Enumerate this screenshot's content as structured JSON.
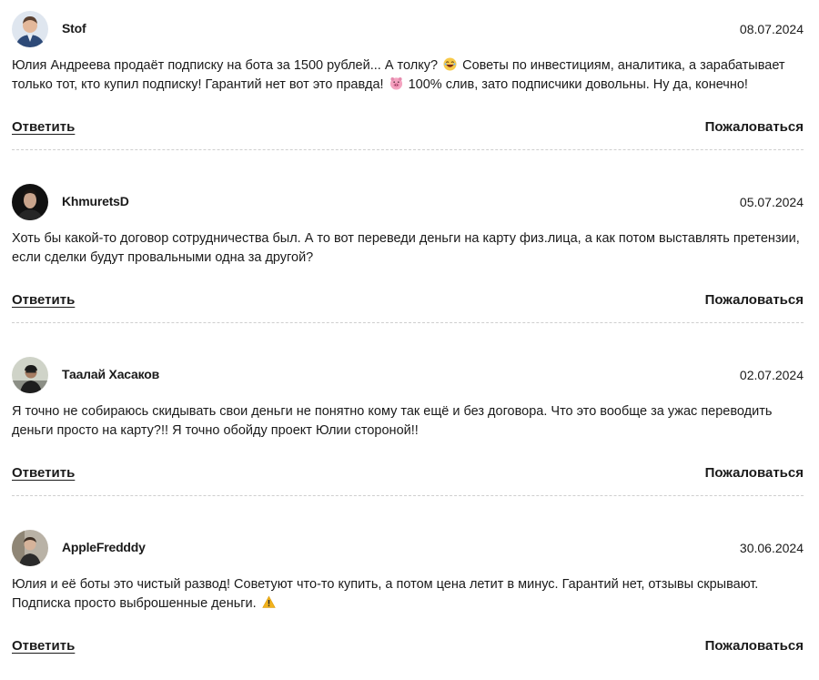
{
  "comments": [
    {
      "author": "Stof",
      "date": "08.07.2024",
      "text_parts": [
        "Юлия Андреева продаёт подписку на бота за 1500 рублей... А толку? ",
        " Советы по инвестициям, аналитика, а зарабатывает только тот, кто купил подписку! Гарантий нет вот это правда! ",
        " 100% слив, зато подписчики довольны. Ну да, конечно!"
      ],
      "emojis": [
        "laughing-emoji",
        "pig-face-emoji"
      ],
      "avatar_icon": "user-avatar-photo",
      "reply_label": "Ответить",
      "report_label": "Пожаловаться"
    },
    {
      "author": "KhmuretsD",
      "date": "05.07.2024",
      "text": "Хоть бы какой-то договор сотрудничества был. А то вот переведи деньги на карту физ.лица, а как потом выставлять претензии, если сделки будут провальными одна за другой?",
      "avatar_icon": "user-avatar-photo",
      "reply_label": "Ответить",
      "report_label": "Пожаловаться"
    },
    {
      "author": "Таалай Хасаков",
      "date": "02.07.2024",
      "text": "Я точно не собираюсь скидывать свои деньги не понятно кому так ещё и без договора. Что это вообще за ужас переводить деньги просто на карту?!! Я точно обойду проект Юлии стороной!!",
      "avatar_icon": "user-avatar-photo",
      "reply_label": "Ответить",
      "report_label": "Пожаловаться"
    },
    {
      "author": "AppleFredddy",
      "date": "30.06.2024",
      "text_parts": [
        "Юлия и её боты это чистый развод! Советуют что-то купить, а потом цена летит в минус. Гарантий нет, отзывы скрывают. Подписка просто выброшенные деньги. "
      ],
      "emojis": [
        "warning-emoji"
      ],
      "avatar_icon": "user-avatar-photo",
      "reply_label": "Ответить",
      "report_label": "Пожаловаться"
    }
  ],
  "colors": {
    "text": "#1a1a1a",
    "divider": "#cfcfcf",
    "background": "#ffffff",
    "warning_emoji": "#f2b21b",
    "laughing_emoji": "#f7c948",
    "pig_emoji": "#f4a3c0"
  }
}
